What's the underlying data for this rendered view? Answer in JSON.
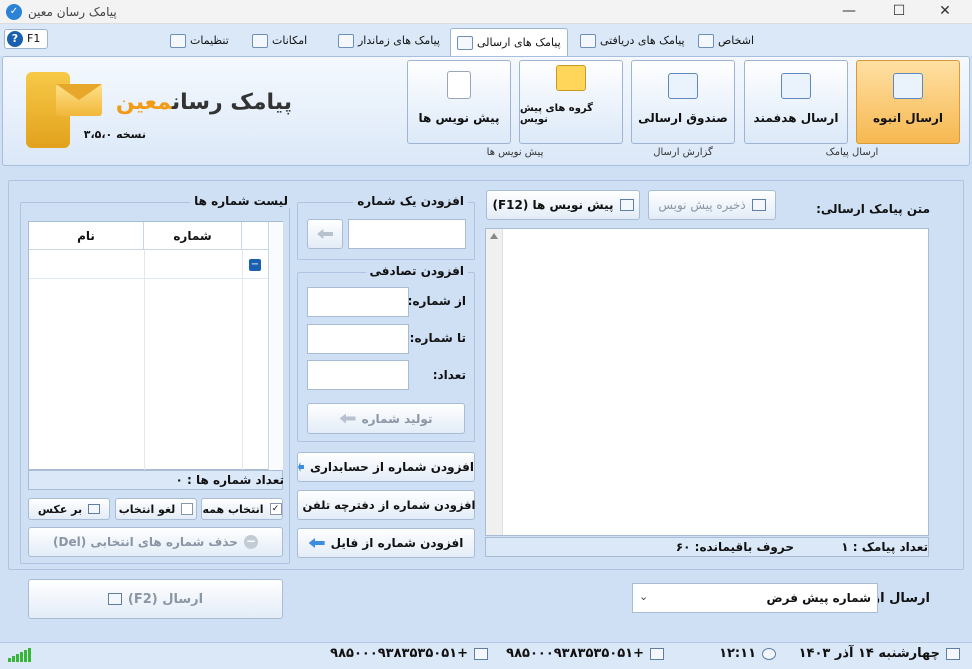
{
  "window": {
    "title": "پیامک رسان معین",
    "minimize": "—",
    "maximize": "☐",
    "close": "✕"
  },
  "help": {
    "label": "F1",
    "glyph": "?"
  },
  "tabs": [
    {
      "label": "اشخاص"
    },
    {
      "label": "پیامک های دریافتی"
    },
    {
      "label": "پیامک های ارسالی"
    },
    {
      "label": "پیامک های زماندار"
    },
    {
      "label": "امکانات"
    },
    {
      "label": "تنظیمات"
    }
  ],
  "brand": {
    "part1": "پیامک رسان",
    "part2": "معین",
    "version": "نسخه ۳،۵،۰"
  },
  "ribbon": {
    "groups": {
      "sms": "ارسال پیامک",
      "report": "گزارش ارسال",
      "drafts": "پیش نویس ها"
    },
    "buttons": {
      "bulk": "ارسال انبوه",
      "targeted": "ارسال هدفمند",
      "outbox": "صندوق ارسالی",
      "draft_groups": "گروه های پیش نویس",
      "drafts": "پیش نویس ها"
    }
  },
  "message": {
    "label": "متن پیامک ارسالی:",
    "save_draft": "ذخیره پیش نویس",
    "drafts_btn": "پیش نویس ها (F12)",
    "count_label": "تعداد پیامک : ۱",
    "remaining_label": "حروف باقیمانده: ۶۰"
  },
  "add_single": {
    "title": "افزودن یک شماره"
  },
  "add_random": {
    "title": "افزودن تصادفی",
    "from": "از شماره:",
    "to": "تا شماره:",
    "count": "تعداد:",
    "generate": "تولید شماره"
  },
  "add_buttons": {
    "accounting": "افزودن شماره از حسابداری",
    "phonebook": "افزودن شماره از دفترچه تلفن",
    "file": "افزودن شماره از فایل"
  },
  "numbers_list": {
    "title": "لیست شماره ها",
    "col_number": "شماره",
    "col_name": "نام",
    "count_label": "تعداد شماره ها : ۰",
    "select_all": "انتخاب همه",
    "deselect": "لغو انتخاب",
    "invert": "بر عکس",
    "delete_selected": "حذف شماره های انتخابی (Del)"
  },
  "send": {
    "label": "ارسال (F2)",
    "from_label": "ارسال از:",
    "from_value": "شماره پیش فرض"
  },
  "status": {
    "date": "چهارشنبه ۱۴ آذر ۱۴۰۳",
    "time": "۱۲:۱۱",
    "line1": "+۹۸۵۰۰۰۹۳۸۳۵۳۵۰۵۱",
    "line2": "+۹۸۵۰۰۰۹۳۸۳۵۳۵۰۵۱"
  }
}
